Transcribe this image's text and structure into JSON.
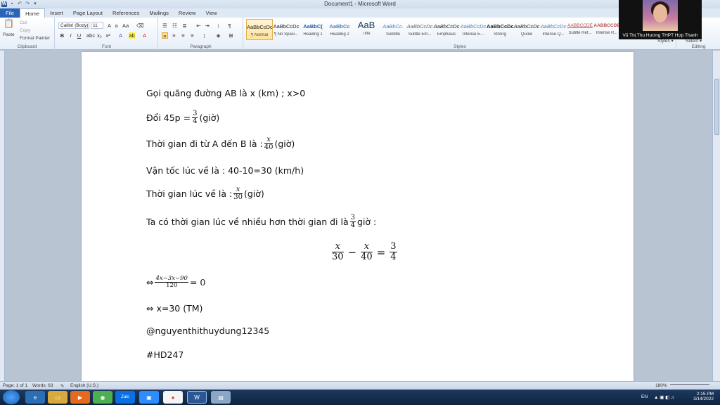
{
  "window": {
    "title": "Document1 - Microsoft Word"
  },
  "tabs": [
    "File",
    "Home",
    "Insert",
    "Page Layout",
    "References",
    "Mailings",
    "Review",
    "View"
  ],
  "ribbon": {
    "clipboard": {
      "label": "Clipboard",
      "paste": "Paste",
      "cut": "Cut",
      "copy": "Copy",
      "format_painter": "Format Painter"
    },
    "font": {
      "label": "Font",
      "font_name": "Calibri (Body)",
      "font_size": "11"
    },
    "paragraph": {
      "label": "Paragraph"
    },
    "styles": {
      "label": "Styles",
      "items": [
        {
          "sample": "AaBbCcDc",
          "name": "¶ Normal"
        },
        {
          "sample": "AaBbCcDc",
          "name": "¶ No Spaci..."
        },
        {
          "sample": "AaBbC(",
          "name": "Heading 1"
        },
        {
          "sample": "AaBbCc",
          "name": "Heading 2"
        },
        {
          "sample": "AaB",
          "name": "Title"
        },
        {
          "sample": "AaBbCc.",
          "name": "Subtitle"
        },
        {
          "sample": "AaBbCcDc",
          "name": "Subtle Em..."
        },
        {
          "sample": "AaBbCcDc",
          "name": "Emphasis"
        },
        {
          "sample": "AaBbCcDc",
          "name": "Intense E..."
        },
        {
          "sample": "AaBbCcDc",
          "name": "Strong"
        },
        {
          "sample": "AaBbCcDc",
          "name": "Quote"
        },
        {
          "sample": "AaBbCcDc",
          "name": "Intense Q..."
        },
        {
          "sample": "AABBCCDE",
          "name": "Subtle Ref..."
        },
        {
          "sample": "AABBCCDE",
          "name": "Intense R..."
        }
      ],
      "change_styles": "Styles ▾"
    },
    "editing": {
      "label": "Editing",
      "select": "Select ▾"
    }
  },
  "document": {
    "line1": "Gọi quãng đường AB là x (km) ; x>0",
    "line2_pre": "Đổi 45p = ",
    "line2_num": "3",
    "line2_den": "4",
    "line2_post": " (giờ)",
    "line3_pre": "Thời gian đi từ A đến B là : ",
    "line3_num": "x",
    "line3_den": "40",
    "line3_post": "(giờ)",
    "line4": "Vận tốc lúc về là : 40-10=30  (km/h)",
    "line5_pre": "Thời gian lúc về là : ",
    "line5_num": "x",
    "line5_den": "30",
    "line5_post": "(giờ)",
    "line6_pre": "Ta có thời gian lúc về nhiều hơn thời gian đi là ",
    "line6_num": "3",
    "line6_den": "4",
    "line6_post": " giờ :",
    "eq": {
      "a_num": "x",
      "a_den": "30",
      "minus": "−",
      "b_num": "x",
      "b_den": "40",
      "eq": "=",
      "c_num": "3",
      "c_den": "4"
    },
    "line8_pre": "⇔ ",
    "line8_num": "4x−3x−90",
    "line8_den": "120",
    "line8_post": " = 0",
    "line9": "⇔ x=30 (TM)",
    "line10": "@nguyenthithuydung12345",
    "line11": "#HD247"
  },
  "status": {
    "page": "Page: 1 of 1",
    "words": "Words: 63",
    "language": "English (U.S.)",
    "zoom": "180%"
  },
  "taskbar": {
    "lang": "EN",
    "time": "2:15 PM",
    "date": "3/14/2022",
    "zalo": "Zalo"
  },
  "webcam": {
    "name": "Vũ Thị Thu Hương THPT Hợp Thanh"
  }
}
